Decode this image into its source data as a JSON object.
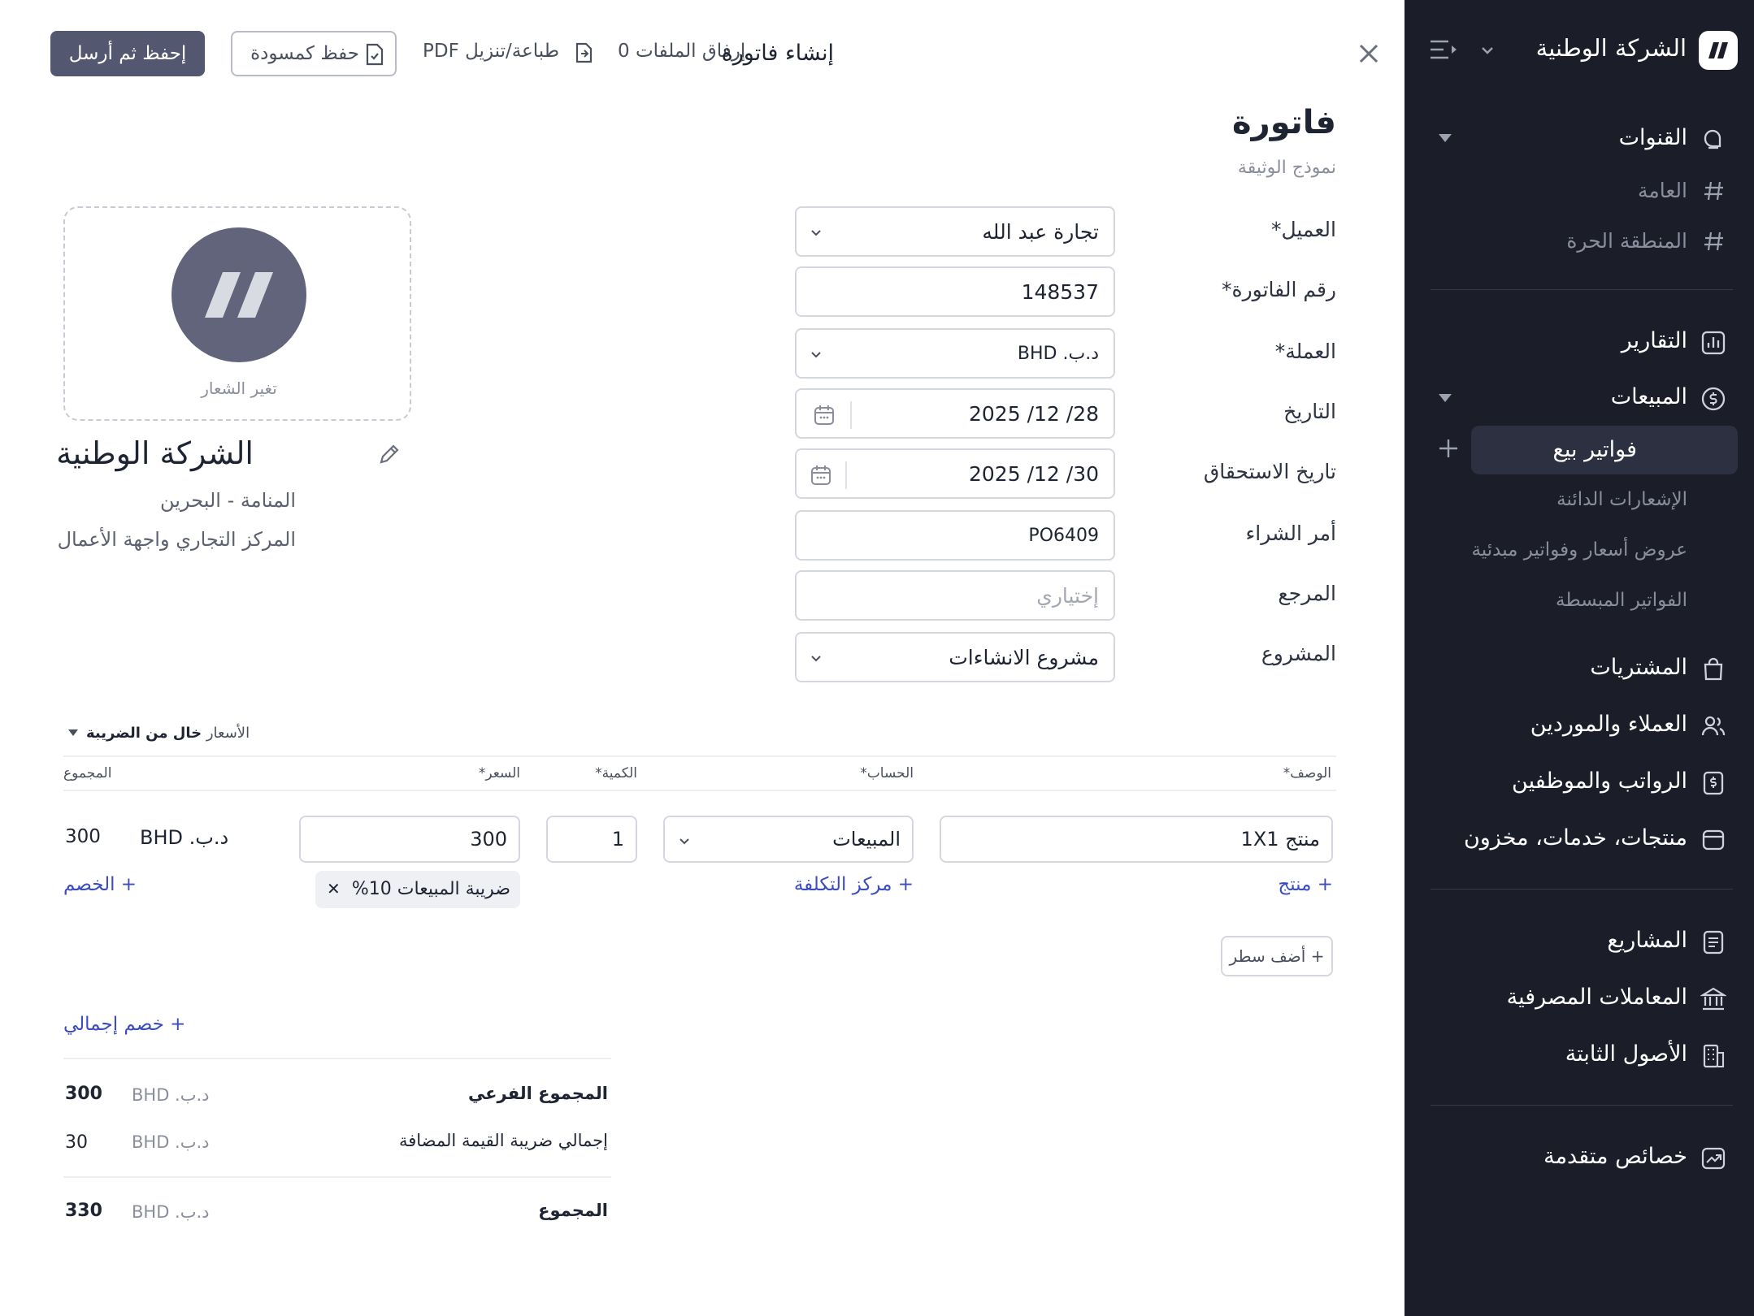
{
  "sidebar": {
    "company": "الشركة الوطنية",
    "sections": [
      {
        "label": "القنوات",
        "icon": "chat-bubble-icon"
      },
      {
        "label": "التقارير",
        "icon": "bar-chart-icon"
      },
      {
        "label": "المبيعات",
        "icon": "dollar-circle-icon"
      },
      {
        "label": "المشتريات",
        "icon": "shopping-bag-icon"
      },
      {
        "label": "العملاء والموردين",
        "icon": "users-icon"
      },
      {
        "label": "الرواتب والموظفين",
        "icon": "payroll-icon"
      },
      {
        "label": "منتجات، خدمات، مخزون",
        "icon": "wallet-icon"
      },
      {
        "label": "المشاريع",
        "icon": "document-icon"
      },
      {
        "label": "المعاملات المصرفية",
        "icon": "bank-icon"
      },
      {
        "label": "الأصول الثابتة",
        "icon": "building-icon"
      },
      {
        "label": "خصائص متقدمة",
        "icon": "trending-up-icon"
      }
    ],
    "channels": [
      "العامة",
      "المنطقة الحرة"
    ],
    "sales_items": [
      "فواتير بيع",
      "الإشعارات الدائنة",
      "عروض أسعار وفواتير مبدئية",
      "الفواتير المبسطة"
    ]
  },
  "topbar": {
    "title": "إنشاء فاتورة",
    "attach": "إرفاق الملفات 0",
    "print": "طباعة/تنزيل PDF",
    "save_draft": "حفظ كمسودة",
    "save_send": "إحفظ ثم أرسل"
  },
  "document": {
    "title": "فاتورة",
    "subtitle": "نموذج الوثيقة"
  },
  "form": {
    "customer": {
      "label": "العميل*",
      "value": "تجارة عبد الله"
    },
    "invoice_number": {
      "label": "رقم الفاتورة*",
      "value": "148537"
    },
    "currency": {
      "label": "العملة*",
      "value": "د.ب. BHD"
    },
    "date": {
      "label": "التاريخ",
      "value": "28/ 12/ 2025"
    },
    "due_date": {
      "label": "تاريخ الاستحقاق",
      "value": "30/ 12/ 2025"
    },
    "purchase_order": {
      "label": "أمر الشراء",
      "value": "PO6409"
    },
    "reference": {
      "label": "المرجع",
      "placeholder": "إختياري"
    },
    "project": {
      "label": "المشروع",
      "value": "مشروع الانشاءات"
    }
  },
  "company_card": {
    "change_logo": "تغير الشعار",
    "name": "الشركة الوطنية",
    "address1": "المنامة - البحرين",
    "address2": "المركز التجاري واجهة الأعمال"
  },
  "lines": {
    "tax_prefix": "الأسعار",
    "tax_mode": "خال من الضريبة",
    "headers": {
      "description": "الوصف*",
      "account": "الحساب*",
      "quantity": "الكمية*",
      "price": "السعر*",
      "total": "المجموع"
    },
    "rows": [
      {
        "description": "منتج 1X1",
        "account": "المبيعات",
        "quantity": "1",
        "price": "300",
        "currency": "د.ب. BHD",
        "total": "300",
        "tax": "ضريبة المبيعات 10%"
      }
    ],
    "add_product": "+ منتج",
    "add_cost_center": "+ مركز التكلفة",
    "add_discount": "+ الخصم",
    "add_line": "+ أضف سطر",
    "global_discount": "+ خصم إجمالي"
  },
  "totals": {
    "currency": "د.ب. BHD",
    "subtotal_label": "المجموع الفرعي",
    "subtotal": "300",
    "vat_label": "إجمالي ضريبة القيمة المضافة",
    "vat": "30",
    "total_label": "المجموع",
    "total": "330"
  },
  "colors": {
    "sidebar_bg": "#1b1e29",
    "primary_button": "#545770",
    "link": "#3b4cc0",
    "logo_circle": "#62647c"
  }
}
